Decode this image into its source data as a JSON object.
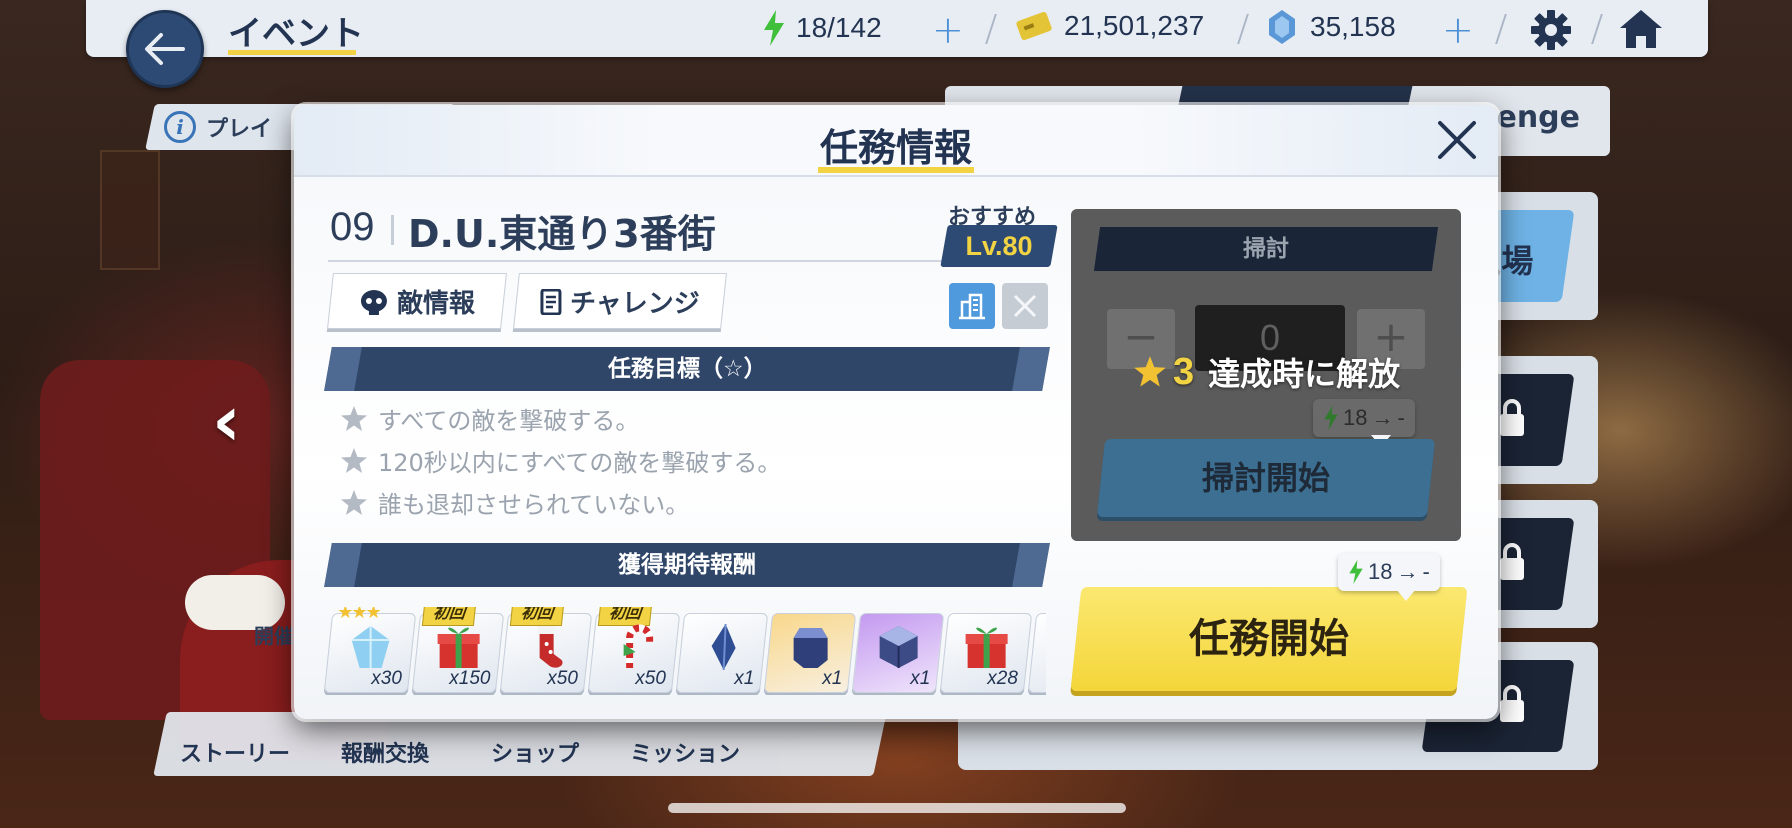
{
  "topbar": {
    "title": "イベント",
    "ap": "18/142",
    "credits": "21,501,237",
    "gems": "35,158"
  },
  "background": {
    "info_text": "プレイ",
    "challenge_text": "enge",
    "enter_text": "入場",
    "kaisai_text": "開催",
    "nav": [
      "ストーリー",
      "報酬交換",
      "ショップ",
      "ミッション"
    ]
  },
  "modal": {
    "title": "任務情報",
    "stage_number": "09",
    "stage_name": "D.U.東通り3番街",
    "recommend_label": "おすすめ",
    "recommend_level": "Lv.80",
    "tabs": {
      "enemy_info": "敵情報",
      "challenge": "チャレンジ"
    },
    "goals_header": "任務目標（☆）",
    "goals": [
      "すべての敵を撃破する。",
      "120秒以内にすべての敵を撃破する。",
      "誰も退却させられていない。"
    ],
    "rewards_header": "獲得期待報酬",
    "rewards": [
      {
        "name": "crystal-icon",
        "count": "x30",
        "badge": "★★★"
      },
      {
        "name": "gift-box-icon",
        "count": "x150",
        "badge": "初回"
      },
      {
        "name": "stocking-icon",
        "count": "x50",
        "badge": "初回"
      },
      {
        "name": "candy-cane-icon",
        "count": "x50",
        "badge": "初回"
      },
      {
        "name": "blue-shard-icon",
        "count": "x1",
        "badge": ""
      },
      {
        "name": "ore-icon",
        "count": "x1",
        "badge": ""
      },
      {
        "name": "cube-icon",
        "count": "x1",
        "badge": ""
      },
      {
        "name": "gift-box-icon",
        "count": "x28",
        "badge": ""
      }
    ],
    "sweep": {
      "header": "掃討",
      "count": "0",
      "minus": "−",
      "plus": "+",
      "unlock_stars": "3",
      "unlock_text": "達成時に解放",
      "cost_from": "18",
      "cost_to": "-",
      "button": "掃討開始"
    },
    "start": {
      "cost_from": "18",
      "cost_to": "-",
      "button": "任務開始"
    }
  },
  "colors": {
    "navy": "#2f4669",
    "accent_yellow": "#f2d343",
    "ap_green": "#3fbf3a",
    "link_blue": "#4b8fd6"
  }
}
